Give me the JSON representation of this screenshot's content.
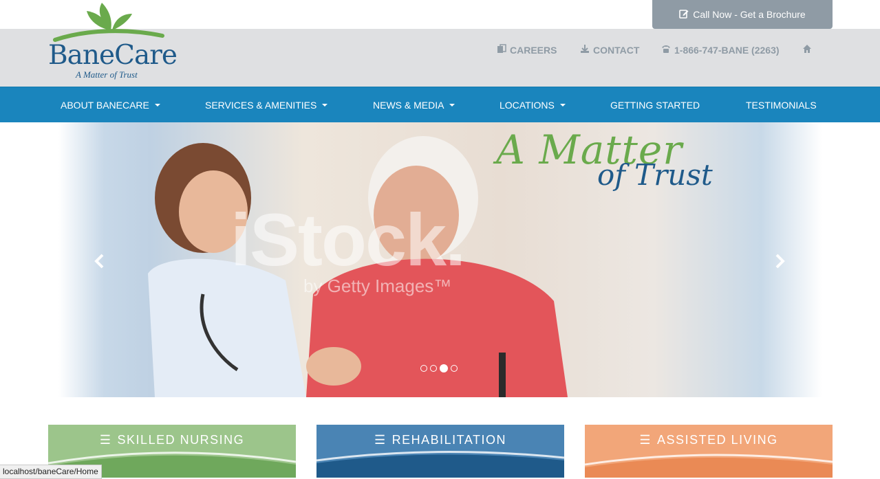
{
  "brochure_button": {
    "label": "Call Now - Get a Brochure",
    "icon": "edit-icon"
  },
  "logo": {
    "brand": "BaneCare",
    "tagline": "A Matter of Trust"
  },
  "utility_links": {
    "careers": "CAREERS",
    "contact": "CONTACT",
    "phone": "1-866-747-BANE (2263)"
  },
  "nav": {
    "about": "ABOUT BANECARE",
    "services": "SERVICES & AMENITIES",
    "news": "NEWS & MEDIA",
    "locations": "LOCATIONS",
    "getting_started": "GETTING STARTED",
    "testimonials": "TESTIMONIALS"
  },
  "carousel": {
    "slogan_line1": "A Matter",
    "slogan_line2": "of Trust",
    "watermark_line1": "iStock.",
    "watermark_line2": "by Getty Images™",
    "slide_count": 4,
    "active_slide": 3
  },
  "services": [
    {
      "title": "SKILLED NURSING",
      "color": "#9cc58b"
    },
    {
      "title": "REHABILITATION",
      "color": "#4a84b4"
    },
    {
      "title": "ASSISTED LIVING",
      "color": "#f2a679"
    }
  ],
  "status_url": "localhost/baneCare/Home",
  "colors": {
    "nav_bg": "#1a85bd",
    "header_bg": "#dfe0e2",
    "brand_blue": "#1f5a8a",
    "brand_green": "#6aaa4c",
    "button_gray": "#8f9ba5"
  }
}
